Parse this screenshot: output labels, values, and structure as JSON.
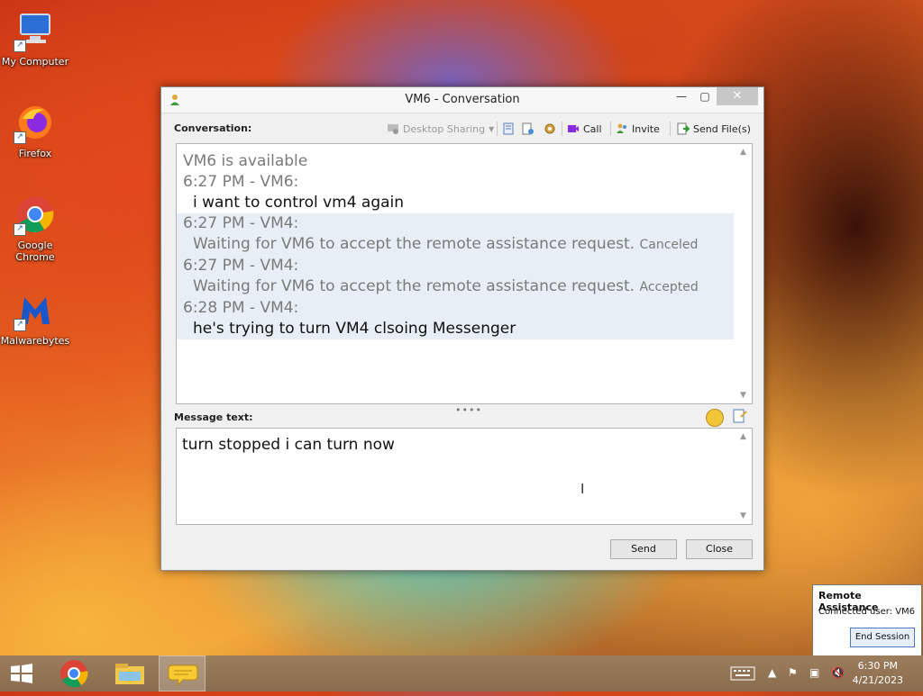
{
  "desktop": {
    "icons": [
      {
        "label": "My Computer"
      },
      {
        "label": "Firefox"
      },
      {
        "label": "Google Chrome"
      },
      {
        "label": "Malwarebytes"
      }
    ]
  },
  "window": {
    "title": "VM6 - Conversation",
    "conversation_label": "Conversation:",
    "toolbar": {
      "desktop_sharing": "Desktop Sharing",
      "call": "Call",
      "invite": "Invite",
      "send_files": "Send File(s)"
    },
    "messages": [
      {
        "text": "VM6 is available"
      },
      {
        "header": "6:27 PM - VM6:",
        "body": "i want to control vm4 again"
      },
      {
        "header": "6:27 PM - VM4:",
        "body": "Waiting for VM6 to accept the remote assistance request.",
        "status": "Canceled"
      },
      {
        "header": "6:27 PM - VM4:",
        "body": "Waiting for VM6 to accept the remote assistance request.",
        "status": "Accepted"
      },
      {
        "header": "6:28 PM - VM4:",
        "body": "he's trying to turn VM4 clsoing Messenger"
      }
    ],
    "message_label": "Message text:",
    "message_value": "turn stopped i can turn now",
    "send_label": "Send",
    "close_label": "Close"
  },
  "remote_assistance": {
    "title": "Remote Assistance",
    "connected": "Connected user:  VM6",
    "end_session": "End Session"
  },
  "taskbar": {
    "time": "6:30 PM",
    "date": "4/21/2023"
  }
}
